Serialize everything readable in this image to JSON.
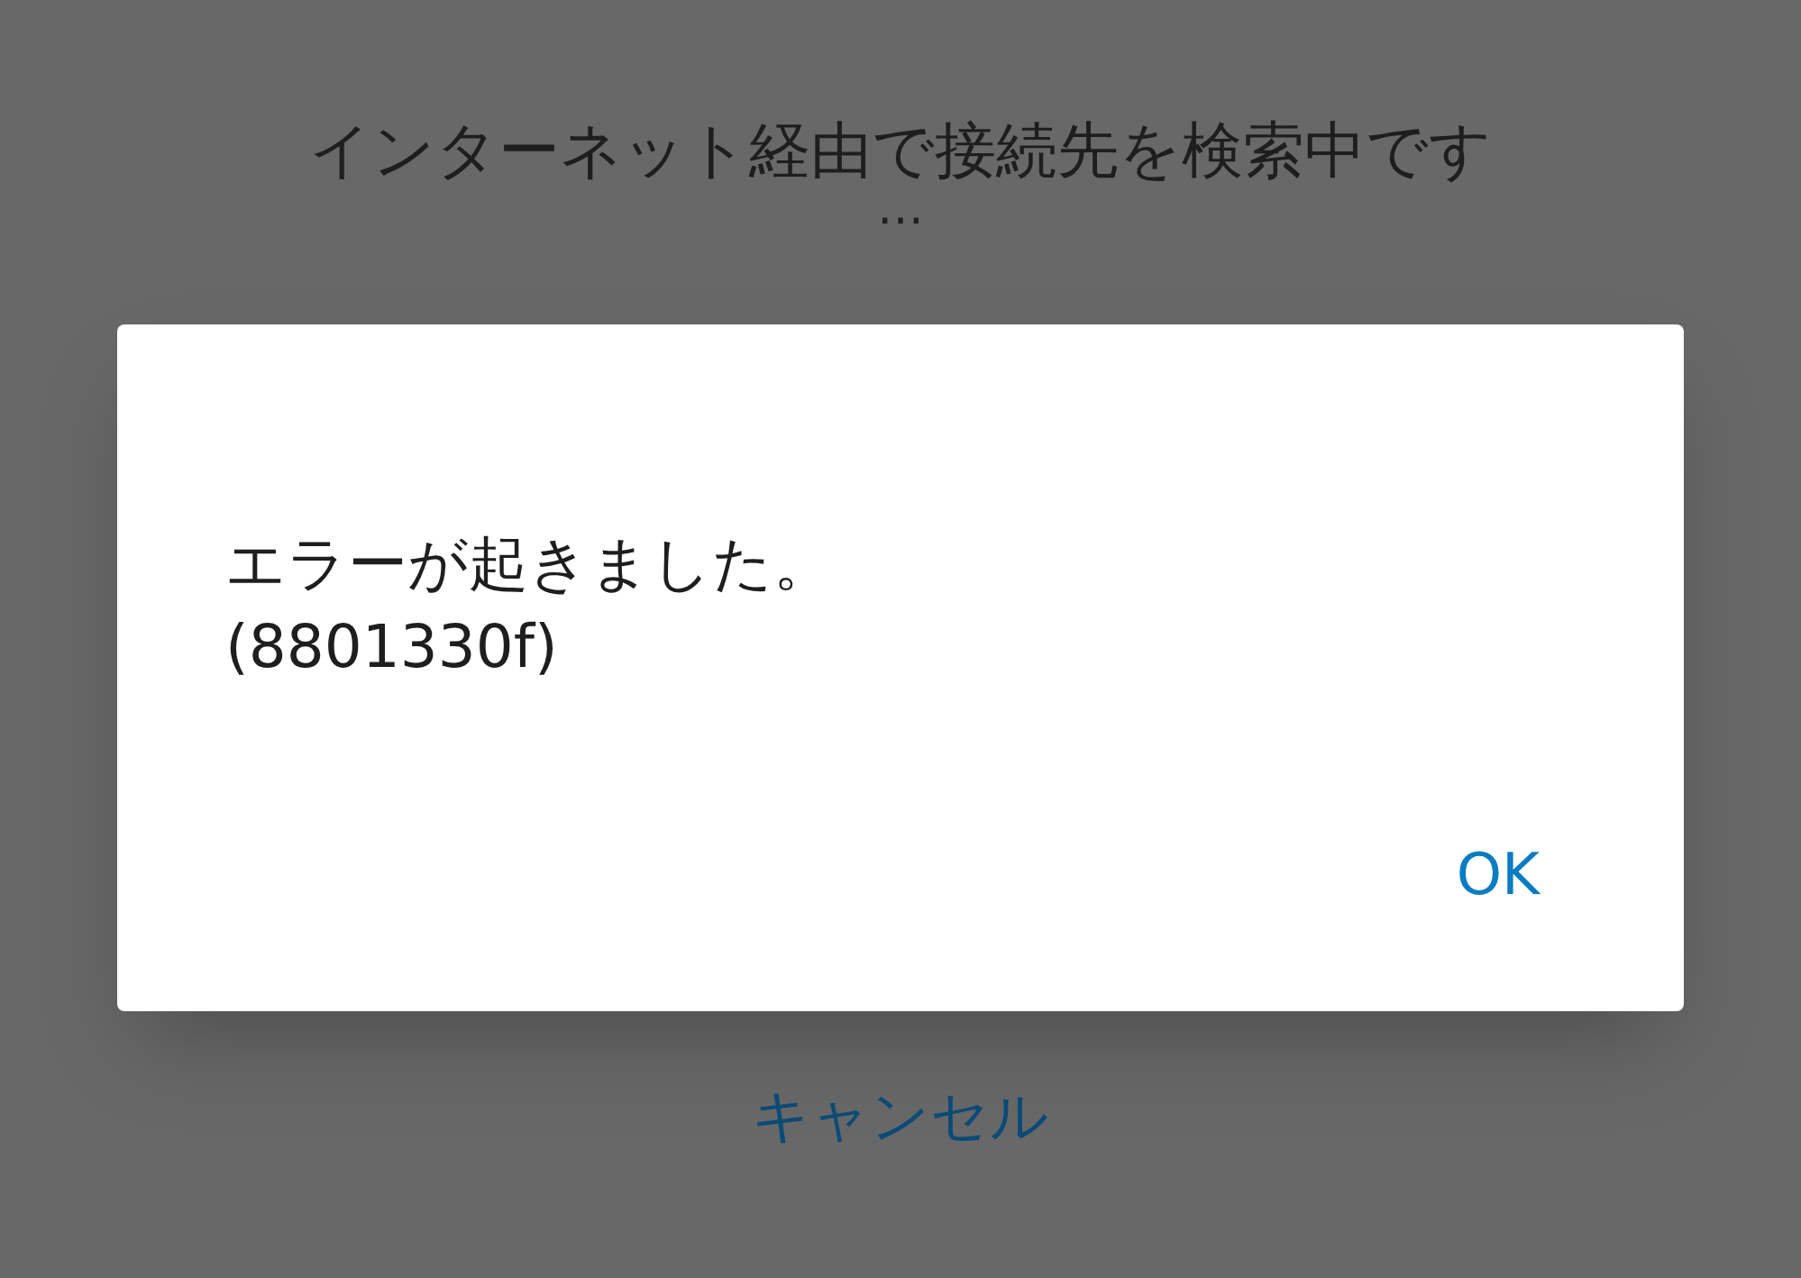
{
  "background": {
    "title": "インターネット経由で接続先を検索中です",
    "ellipsis": "…",
    "cancel_link": "キャンセル"
  },
  "dialog": {
    "message": "エラーが起きました。",
    "code": "(8801330f)",
    "buttons": [
      "OK"
    ]
  }
}
